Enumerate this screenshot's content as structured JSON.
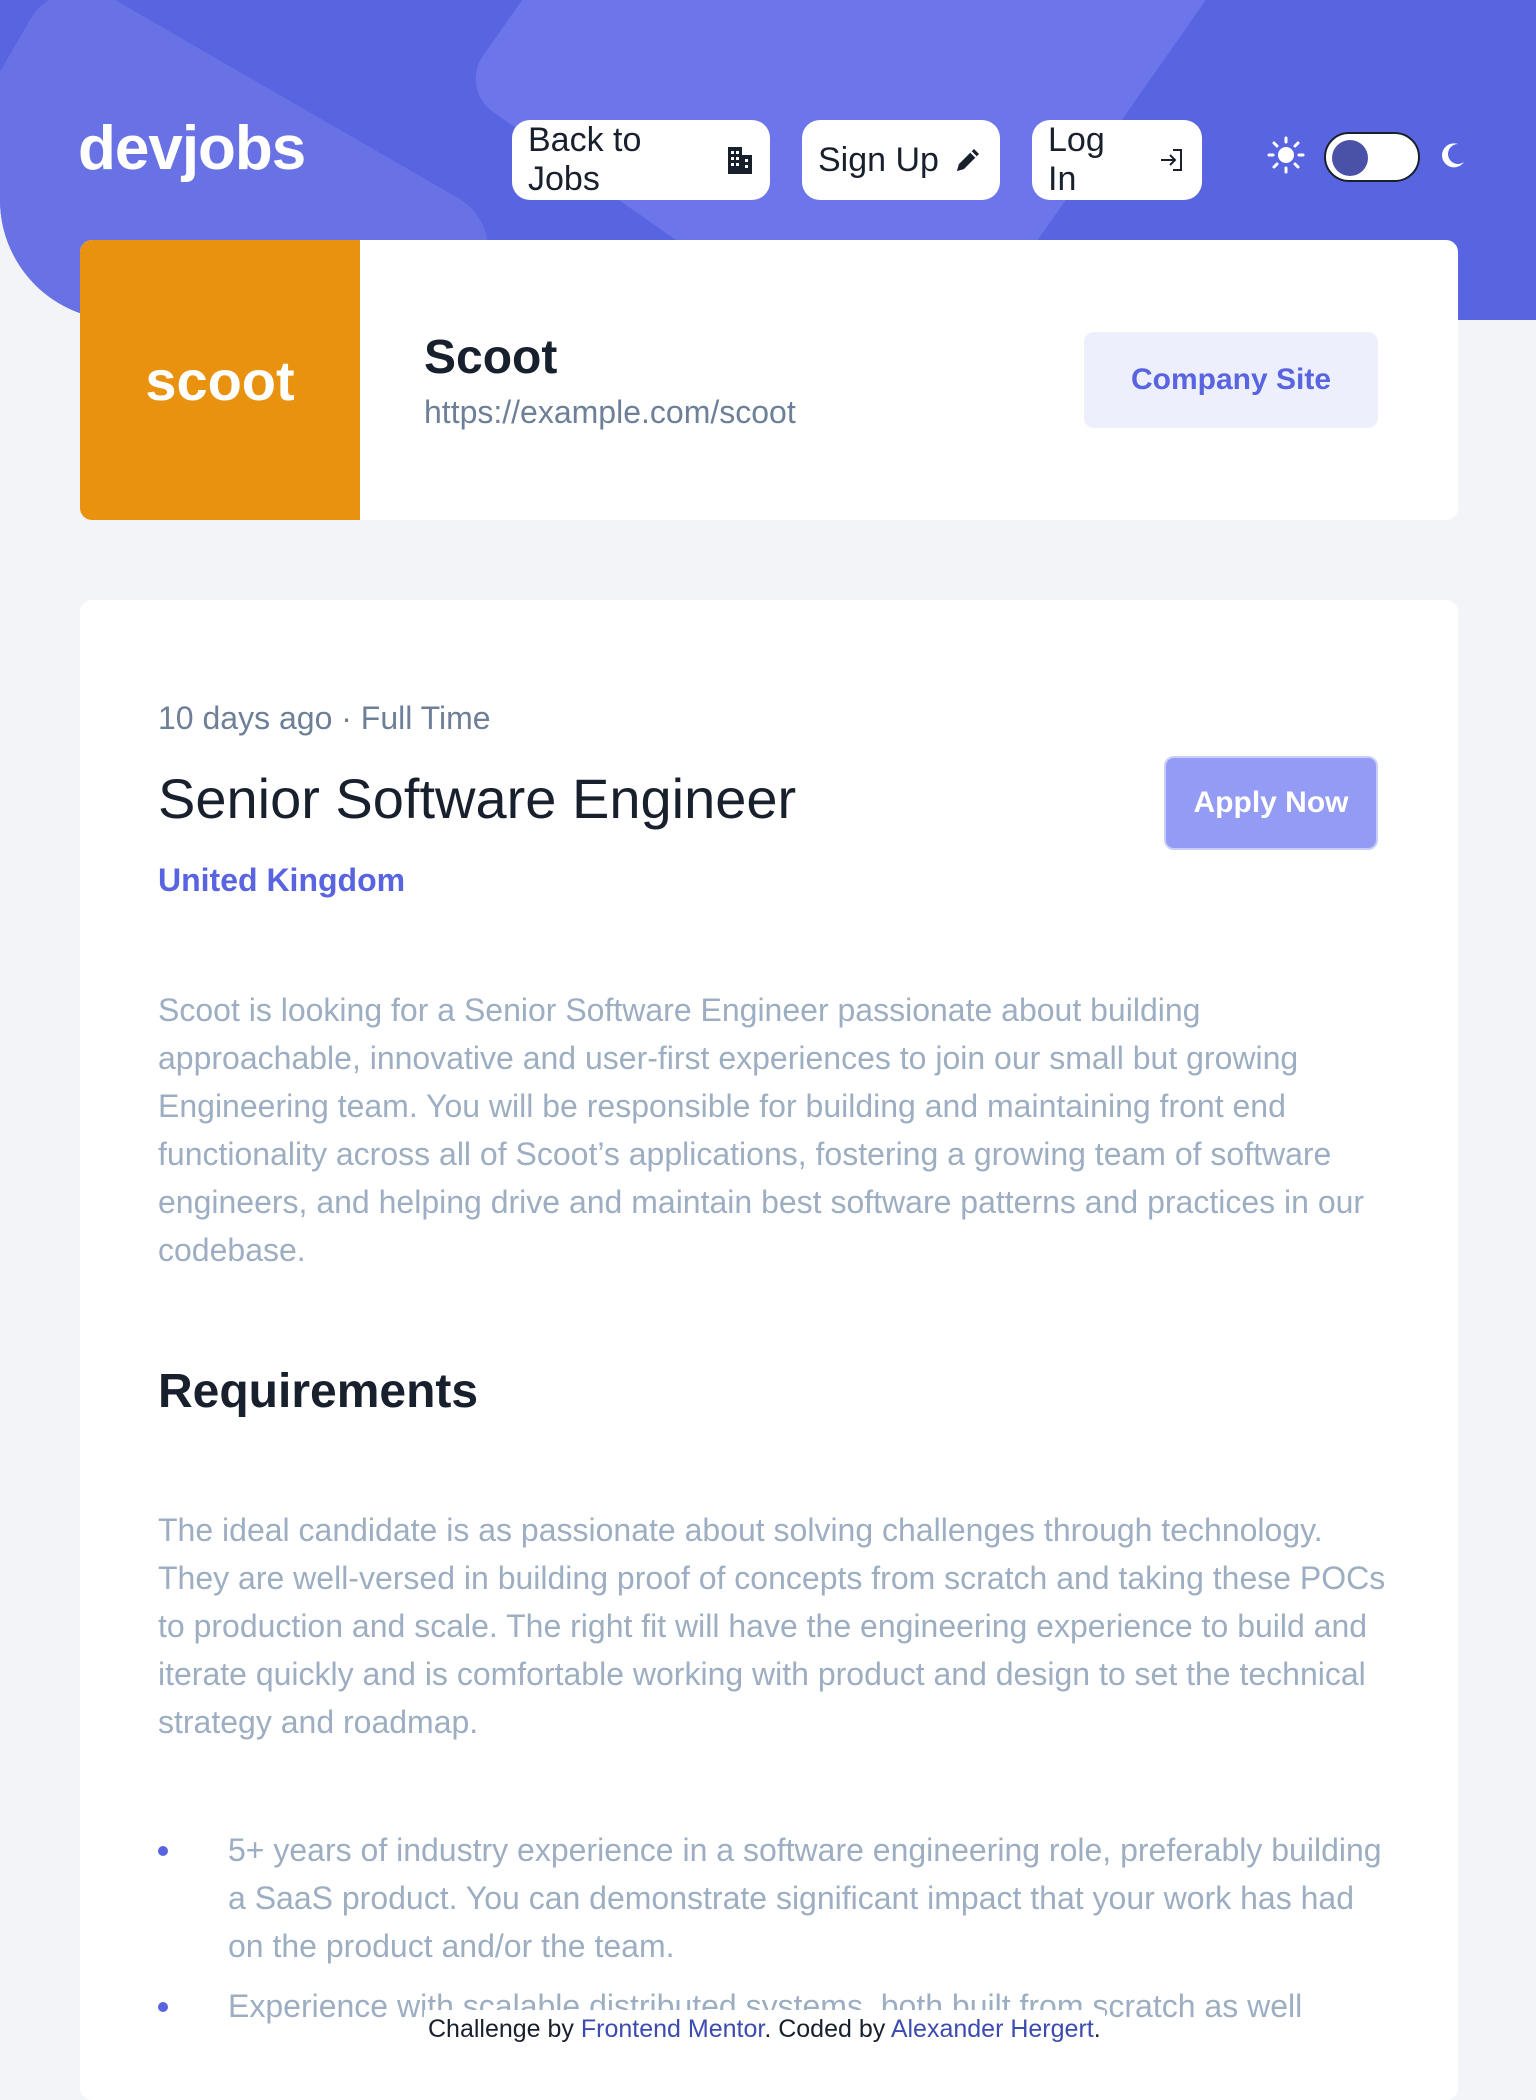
{
  "header": {
    "logo": "devjobs",
    "nav": {
      "back_label": "Back to Jobs",
      "signup_label": "Sign Up",
      "login_label": "Log In"
    },
    "icons": {
      "back": "building-icon",
      "signup": "pencil-icon",
      "login": "login-icon",
      "light": "sun-icon",
      "dark": "moon-icon"
    },
    "colors": {
      "brand": "#5964e0"
    }
  },
  "company": {
    "logo_text": "scoot",
    "name": "Scoot",
    "url": "https://example.com/scoot",
    "site_button": "Company Site",
    "logo_color": "#e99210"
  },
  "job": {
    "posted": "10 days ago",
    "separator": "·",
    "contract": "Full Time",
    "title": "Senior Software Engineer",
    "location": "United Kingdom",
    "apply_label": "Apply Now",
    "description": "Scoot is looking for a Senior Software Engineer passionate about building approachable, innovative and user-first experiences to join our small but growing Engineering team. You will be responsible for building and maintaining front end functionality across all of Scoot’s applications, fostering a growing team of software engineers, and helping drive and maintain best software patterns and practices in our codebase."
  },
  "requirements": {
    "heading": "Requirements",
    "text": "The ideal candidate is as passionate about solving challenges through technology. They are well-versed in building proof of concepts from scratch and taking these POCs to production and scale. The right fit will have the engineering experience to build and iterate quickly and is comfortable working with product and design to set the technical strategy and roadmap.",
    "items": [
      "5+ years of industry experience in a software engineering role, preferably building a SaaS product. You can demonstrate significant impact that your work has had on the product and/or the team.",
      "Experience with scalable distributed systems, both built from scratch as well"
    ]
  },
  "attribution": {
    "prefix": "Challenge by",
    "mentor": "Frontend Mentor",
    "middle": ". Coded by",
    "author": "Alexander Hergert",
    "suffix": "."
  }
}
